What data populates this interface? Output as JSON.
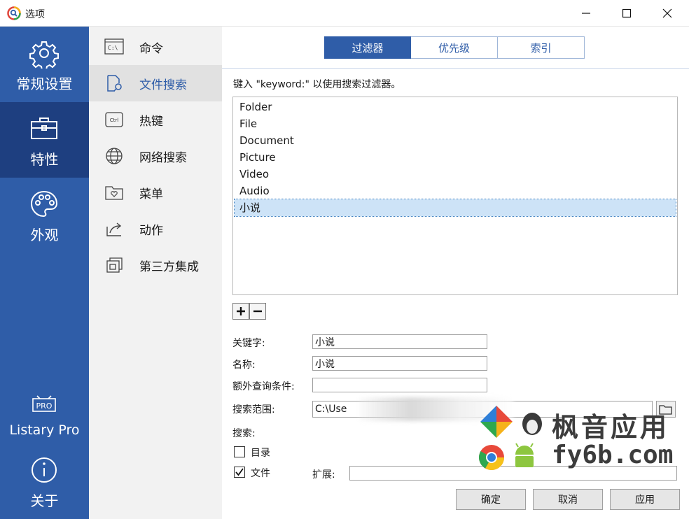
{
  "window": {
    "title": "选项"
  },
  "categories": [
    {
      "label": "常规设置",
      "icon": "gear-icon"
    },
    {
      "label": "特性",
      "icon": "toolbox-icon"
    },
    {
      "label": "外观",
      "icon": "palette-icon"
    },
    {
      "label": "Listary Pro",
      "icon": "pro-badge-icon"
    },
    {
      "label": "关于",
      "icon": "info-icon"
    }
  ],
  "sub_nav": [
    {
      "label": "命令",
      "icon": "command-prompt-icon"
    },
    {
      "label": "文件搜索",
      "icon": "file-search-icon"
    },
    {
      "label": "热键",
      "icon": "ctrl-key-icon"
    },
    {
      "label": "网络搜索",
      "icon": "globe-icon"
    },
    {
      "label": "菜单",
      "icon": "menu-folder-icon"
    },
    {
      "label": "动作",
      "icon": "share-arrow-icon"
    },
    {
      "label": "第三方集成",
      "icon": "integration-icon"
    }
  ],
  "tabs": [
    {
      "label": "过滤器"
    },
    {
      "label": "优先级"
    },
    {
      "label": "索引"
    }
  ],
  "hint": "键入 \"keyword:\" 以使用搜索过滤器。",
  "filters": [
    "Folder",
    "File",
    "Document",
    "Picture",
    "Video",
    "Audio",
    "小说"
  ],
  "form": {
    "keyword_label": "关键字:",
    "keyword_value": "小说",
    "name_label": "名称:",
    "name_value": "小说",
    "extra_label": "额外查询条件:",
    "extra_value": "",
    "scope_label": "搜索范围:",
    "scope_value": "C:\\Use",
    "search_label": "搜索:",
    "dir_label": "目录",
    "file_label": "文件",
    "ext_label": "扩展:",
    "ext_value": ""
  },
  "buttons": {
    "ok": "确定",
    "cancel": "取消",
    "apply": "应用"
  },
  "watermark": {
    "line1": "枫音应用",
    "line2": "fy6b.com"
  },
  "colors": {
    "accent": "#2f5da8",
    "active_category": "#1e3f80"
  }
}
